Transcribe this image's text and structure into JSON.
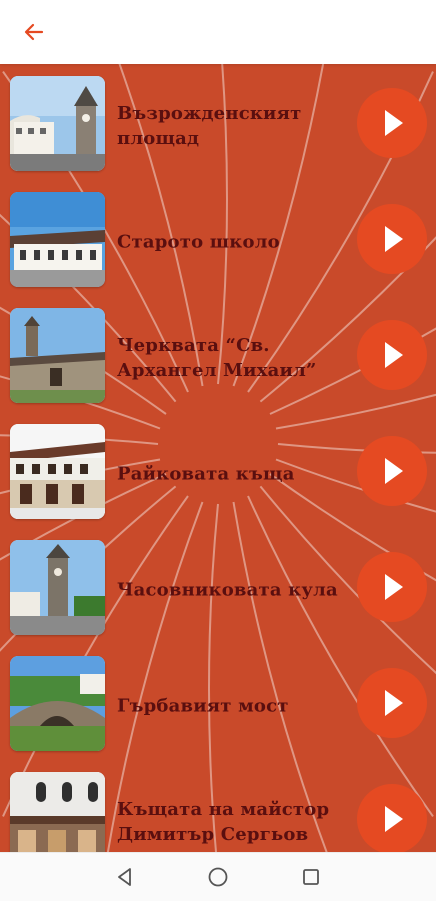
{
  "header": {
    "back_icon": "arrow-left-icon",
    "accent_color": "#e54a22"
  },
  "colors": {
    "title": "#5a0f0f",
    "play_button": "#e54a22",
    "background": "#c94a2a"
  },
  "items": [
    {
      "title": "Възрожденският площад",
      "thumbnail": "town-square-with-clock-tower",
      "action_icon": "play-icon"
    },
    {
      "title": "Старото школо",
      "thumbnail": "old-school-building",
      "action_icon": "play-icon"
    },
    {
      "title": "Черквата “Св. Архангел Михаил”",
      "thumbnail": "stone-church-with-bell-tower",
      "action_icon": "play-icon"
    },
    {
      "title": "Райковата къща",
      "thumbnail": "raikova-house",
      "action_icon": "play-icon"
    },
    {
      "title": "Часовниковата кула",
      "thumbnail": "clock-tower",
      "action_icon": "play-icon"
    },
    {
      "title": "Гърбавият мост",
      "thumbnail": "humpback-stone-bridge",
      "action_icon": "play-icon"
    },
    {
      "title": "Къщата на майстор Димитър Сергьов",
      "thumbnail": "master-house",
      "action_icon": "play-icon"
    }
  ],
  "navbar": {
    "back": "triangle-back-icon",
    "home": "circle-home-icon",
    "recents": "square-recents-icon"
  }
}
